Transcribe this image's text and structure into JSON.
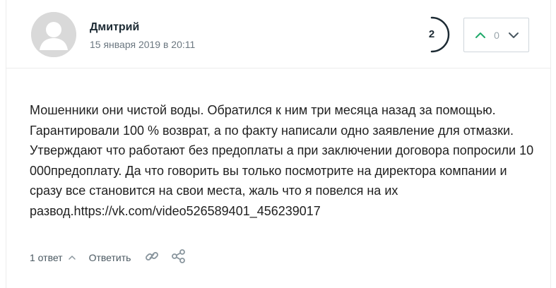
{
  "comment": {
    "author": "Дмитрий",
    "date": "15 января 2019 в 20:11",
    "rating": "2",
    "votes": "0",
    "text": "Мошенники они чистой воды. Обратился к ним три месяца назад за помощью. Гарантировали 100 % возврат, а по факту написали одно заявление для отмазки. Утверждают что работают без предоплаты а при заключении договора попросили 10 000предоплату. Да что говорить вы только посмотрите на директора компании и сразу все становится на свои места, жаль что я повелся на их развод.https://vk.com/video526589401_456239017",
    "replies_label": "1 ответ",
    "reply_label": "Ответить"
  },
  "colors": {
    "accent_green": "#1fa96a",
    "rating_ring": "#1c2a33",
    "avatar_bg": "#d9d9d9",
    "icon_gray": "#8a969e"
  },
  "icons": {
    "vote_up": "chevron-up-icon",
    "vote_down": "chevron-down-icon",
    "replies_toggle": "chevron-up-icon",
    "link": "link-icon",
    "share": "share-icon"
  }
}
